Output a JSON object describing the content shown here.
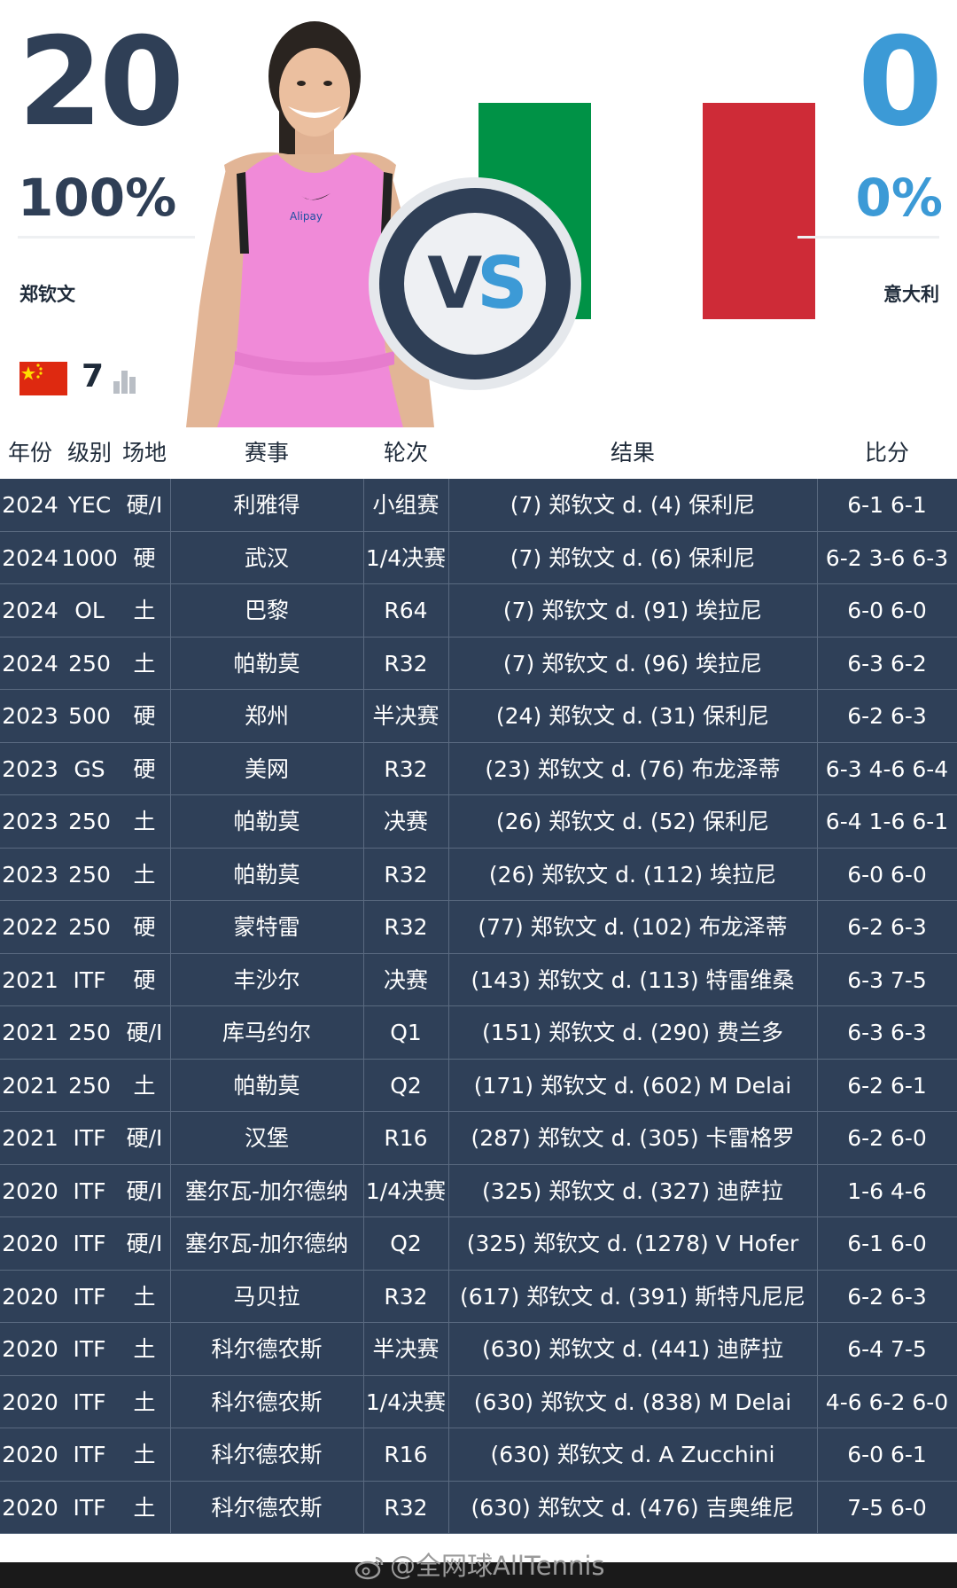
{
  "header": {
    "left": {
      "wins": "20",
      "pct": "100%",
      "name": "郑钦文",
      "rank": "7",
      "flag": "china-flag-icon"
    },
    "right": {
      "wins": "0",
      "pct": "0%",
      "name": "意大利",
      "flag": "italy-flag-icon"
    },
    "vs": {
      "v": "V",
      "s": "S"
    },
    "colors": {
      "dark": "#2f3f56",
      "accent": "#3c9ad6",
      "table_bg": "#2f4058"
    }
  },
  "table": {
    "headers": [
      "年份",
      "级别",
      "场地",
      "赛事",
      "轮次",
      "结果",
      "比分"
    ],
    "rows": [
      {
        "year": "2024",
        "level": "YEC",
        "surface": "硬/I",
        "event": "利雅得",
        "round": "小组赛",
        "result": "(7) 郑钦文 d. (4) 保利尼",
        "score": "6-1 6-1"
      },
      {
        "year": "2024",
        "level": "1000",
        "surface": "硬",
        "event": "武汉",
        "round": "1/4决赛",
        "result": "(7) 郑钦文 d. (6) 保利尼",
        "score": "6-2 3-6 6-3"
      },
      {
        "year": "2024",
        "level": "OL",
        "surface": "土",
        "event": "巴黎",
        "round": "R64",
        "result": "(7) 郑钦文 d. (91) 埃拉尼",
        "score": "6-0 6-0"
      },
      {
        "year": "2024",
        "level": "250",
        "surface": "土",
        "event": "帕勒莫",
        "round": "R32",
        "result": "(7) 郑钦文 d. (96) 埃拉尼",
        "score": "6-3 6-2"
      },
      {
        "year": "2023",
        "level": "500",
        "surface": "硬",
        "event": "郑州",
        "round": "半决赛",
        "result": "(24) 郑钦文 d. (31) 保利尼",
        "score": "6-2 6-3"
      },
      {
        "year": "2023",
        "level": "GS",
        "surface": "硬",
        "event": "美网",
        "round": "R32",
        "result": "(23) 郑钦文 d. (76) 布龙泽蒂",
        "score": "6-3 4-6 6-4"
      },
      {
        "year": "2023",
        "level": "250",
        "surface": "土",
        "event": "帕勒莫",
        "round": "决赛",
        "result": "(26) 郑钦文 d. (52) 保利尼",
        "score": "6-4 1-6 6-1"
      },
      {
        "year": "2023",
        "level": "250",
        "surface": "土",
        "event": "帕勒莫",
        "round": "R32",
        "result": "(26) 郑钦文 d. (112) 埃拉尼",
        "score": "6-0 6-0"
      },
      {
        "year": "2022",
        "level": "250",
        "surface": "硬",
        "event": "蒙特雷",
        "round": "R32",
        "result": "(77) 郑钦文 d. (102) 布龙泽蒂",
        "score": "6-2 6-3"
      },
      {
        "year": "2021",
        "level": "ITF",
        "surface": "硬",
        "event": "丰沙尔",
        "round": "决赛",
        "result": "(143) 郑钦文 d. (113) 特雷维桑",
        "score": "6-3 7-5"
      },
      {
        "year": "2021",
        "level": "250",
        "surface": "硬/I",
        "event": "库马约尔",
        "round": "Q1",
        "result": "(151) 郑钦文 d. (290) 费兰多",
        "score": "6-3 6-3"
      },
      {
        "year": "2021",
        "level": "250",
        "surface": "土",
        "event": "帕勒莫",
        "round": "Q2",
        "result": "(171) 郑钦文 d. (602) M Delai",
        "score": "6-2 6-1"
      },
      {
        "year": "2021",
        "level": "ITF",
        "surface": "硬/I",
        "event": "汉堡",
        "round": "R16",
        "result": "(287) 郑钦文 d. (305) 卡雷格罗",
        "score": "6-2 6-0"
      },
      {
        "year": "2020",
        "level": "ITF",
        "surface": "硬/I",
        "event": "塞尔瓦-加尔德纳",
        "round": "1/4决赛",
        "result": "(325) 郑钦文 d. (327) 迪萨拉",
        "score": "1-6 4-6"
      },
      {
        "year": "2020",
        "level": "ITF",
        "surface": "硬/I",
        "event": "塞尔瓦-加尔德纳",
        "round": "Q2",
        "result": "(325) 郑钦文 d. (1278) V Hofer",
        "score": "6-1 6-0"
      },
      {
        "year": "2020",
        "level": "ITF",
        "surface": "土",
        "event": "马贝拉",
        "round": "R32",
        "result": "(617) 郑钦文 d. (391) 斯特凡尼尼",
        "score": "6-2 6-3"
      },
      {
        "year": "2020",
        "level": "ITF",
        "surface": "土",
        "event": "科尔德农斯",
        "round": "半决赛",
        "result": "(630) 郑钦文 d. (441) 迪萨拉",
        "score": "6-4 7-5"
      },
      {
        "year": "2020",
        "level": "ITF",
        "surface": "土",
        "event": "科尔德农斯",
        "round": "1/4决赛",
        "result": "(630) 郑钦文 d. (838) M Delai",
        "score": "4-6 6-2 6-0"
      },
      {
        "year": "2020",
        "level": "ITF",
        "surface": "土",
        "event": "科尔德农斯",
        "round": "R16",
        "result": "(630) 郑钦文 d. A Zucchini",
        "score": "6-0 6-1"
      },
      {
        "year": "2020",
        "level": "ITF",
        "surface": "土",
        "event": "科尔德农斯",
        "round": "R32",
        "result": "(630) 郑钦文 d. (476) 吉奥维尼",
        "score": "7-5 6-0"
      }
    ]
  },
  "footer": {
    "watermark": "@全网球AllTennis"
  }
}
